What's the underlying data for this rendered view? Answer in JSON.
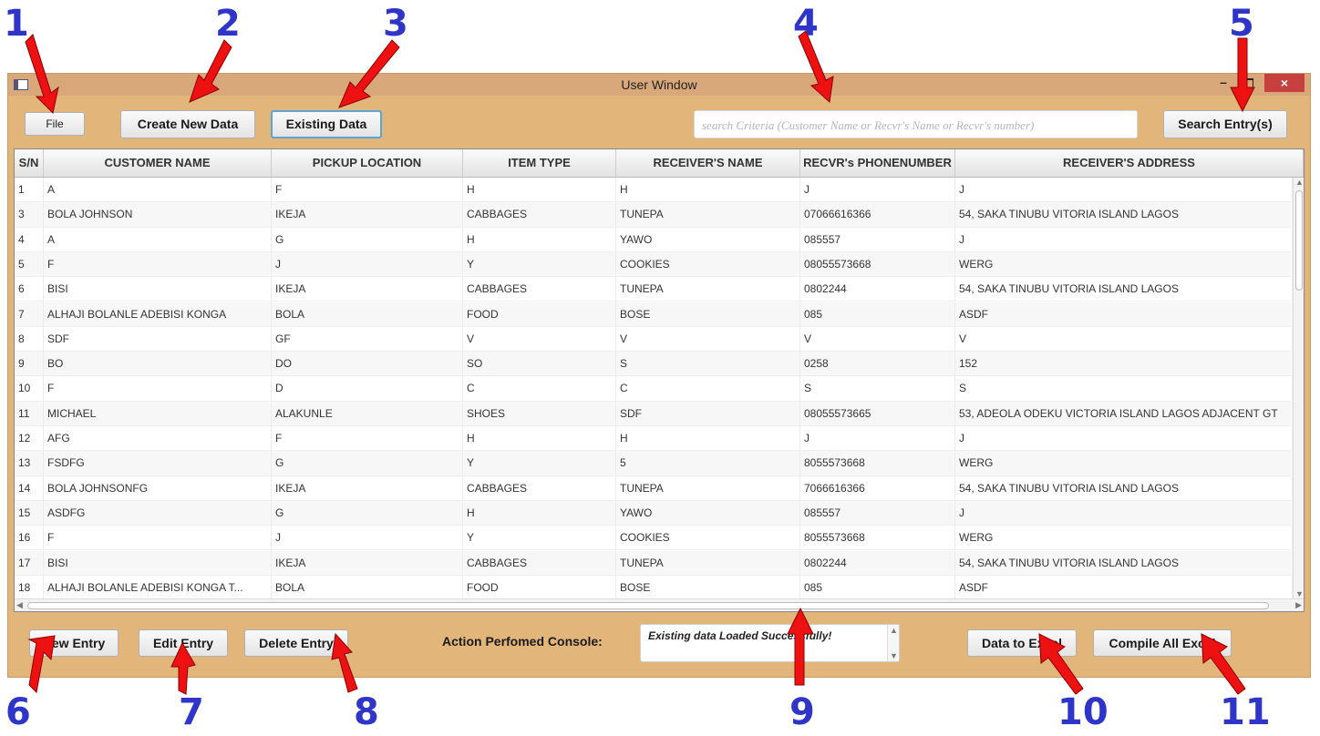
{
  "annotations": [
    "1",
    "2",
    "3",
    "4",
    "5",
    "6",
    "7",
    "8",
    "9",
    "10",
    "11"
  ],
  "window": {
    "title": "User Window",
    "minimize_label": "–",
    "close_label": "×"
  },
  "toolbar": {
    "file_label": "File",
    "create_label": "Create New Data",
    "existing_label": "Existing Data",
    "search_placeholder": "search Criteria  (Customer Name or Recvr's Name or Recvr's number)",
    "search_button": "Search Entry(s)"
  },
  "table": {
    "headers": [
      "S/N",
      "CUSTOMER NAME",
      "PICKUP LOCATION",
      "ITEM TYPE",
      "RECEIVER'S NAME",
      "RECVR's PHONENUMBER",
      "RECEIVER'S ADDRESS"
    ],
    "rows": [
      [
        "1",
        "A",
        "F",
        "H",
        "H",
        "J",
        "J"
      ],
      [
        "3",
        "BOLA JOHNSON",
        "IKEJA",
        "CABBAGES",
        "TUNEPA",
        "07066616366",
        "54, SAKA TINUBU VITORIA ISLAND LAGOS"
      ],
      [
        "4",
        "A",
        "G",
        "H",
        "YAWO",
        "085557",
        "J"
      ],
      [
        "5",
        "F",
        "J",
        "Y",
        "COOKIES",
        "08055573668",
        "WERG"
      ],
      [
        "6",
        "BISI",
        "IKEJA",
        "CABBAGES",
        "TUNEPA",
        "0802244",
        "54, SAKA TINUBU VITORIA ISLAND LAGOS"
      ],
      [
        "7",
        "ALHAJI BOLANLE ADEBISI KONGA",
        "BOLA",
        "FOOD",
        "BOSE",
        "085",
        "ASDF"
      ],
      [
        "8",
        "SDF",
        "GF",
        "V",
        "V",
        "V",
        "V"
      ],
      [
        "9",
        "BO",
        "DO",
        "SO",
        "S",
        "0258",
        "152"
      ],
      [
        "10",
        "F",
        "D",
        "C",
        "C",
        "S",
        "S"
      ],
      [
        "11",
        "MICHAEL",
        "ALAKUNLE",
        "SHOES",
        "SDF",
        "08055573665",
        "53, ADEOLA ODEKU VICTORIA ISLAND LAGOS ADJACENT GT"
      ],
      [
        "12",
        "AFG",
        "F",
        "H",
        "H",
        "J",
        "J"
      ],
      [
        "13",
        "FSDFG",
        "G",
        "Y",
        "5",
        "8055573668",
        "WERG"
      ],
      [
        "14",
        "BOLA JOHNSONFG",
        "IKEJA",
        "CABBAGES",
        "TUNEPA",
        "7066616366",
        "54, SAKA TINUBU VITORIA ISLAND LAGOS"
      ],
      [
        "15",
        "ASDFG",
        "G",
        "H",
        "YAWO",
        "085557",
        "J"
      ],
      [
        "16",
        "F",
        "J",
        "Y",
        "COOKIES",
        "8055573668",
        "WERG"
      ],
      [
        "17",
        "BISI",
        "IKEJA",
        "CABBAGES",
        "TUNEPA",
        "0802244",
        "54, SAKA TINUBU VITORIA ISLAND LAGOS"
      ],
      [
        "18",
        "ALHAJI BOLANLE ADEBISI KONGA T...",
        "BOLA",
        "FOOD",
        "BOSE",
        "085",
        "ASDF"
      ]
    ]
  },
  "bottom": {
    "new_entry": "New Entry",
    "edit_entry": "Edit Entry",
    "delete_entry": "Delete Entry",
    "console_label": "Action Perfomed Console:",
    "console_text": "Existing data Loaded Successfully!",
    "data_to_excel": "Data to Excel",
    "compile_all": "Compile All Excel"
  },
  "colors": {
    "window_bg": "#e2b57a",
    "annotation_number": "#2f35c8",
    "annotation_arrow": "#ee1111"
  }
}
